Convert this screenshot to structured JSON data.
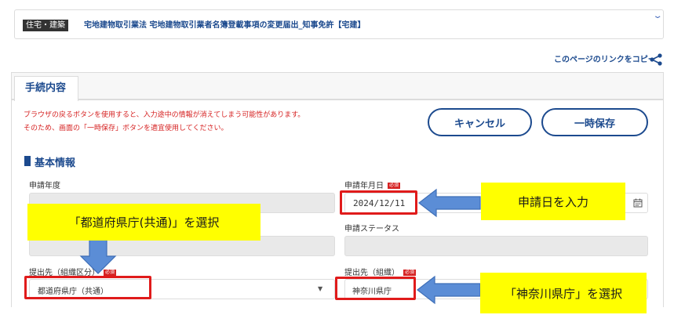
{
  "header": {
    "category_badge": "住宅・建築",
    "procedure_title": "宅地建物取引業法 宅地建物取引業者名簿登載事項の変更届出_知事免許【宅建】",
    "copy_link_label": "このページのリンクをコピー"
  },
  "tabs": [
    {
      "label": "手続内容",
      "active": true
    }
  ],
  "warnings": [
    "ブラウザの戻るボタンを使用すると、入力途中の情報が消えてしまう可能性があります。",
    "そのため、画面の「一時保存」ボタンを適宜使用してください。"
  ],
  "buttons": {
    "cancel": "キャンセル",
    "save_temp": "一時保存"
  },
  "section": {
    "title": "基本情報"
  },
  "required_badge": "必須",
  "fields": {
    "application_year": {
      "label": "申請年度",
      "value": ""
    },
    "application_date": {
      "label": "申請年月日",
      "value": "2024/12/11"
    },
    "application_status": {
      "label": "申請ステータス",
      "value": ""
    },
    "destination_type": {
      "label": "提出先（組織区分）",
      "value": "都道府県庁（共通）"
    },
    "destination_org": {
      "label": "提出先（組織）",
      "value": "神奈川県庁"
    }
  },
  "annotations": {
    "date_callout": "申請日を入力",
    "prefecture_callout": "「都道府県庁(共通)」を選択",
    "kanagawa_callout": "「神奈川県庁」を選択"
  },
  "colors": {
    "brand_blue": "#1c4a8e",
    "warning_red": "#d62222",
    "highlight_red": "#e01b1b",
    "callout_yellow": "#ffff00",
    "arrow_blue": "#5b8dd6"
  },
  "icons": [
    "chevron-down-icon",
    "share-icon",
    "calendar-icon",
    "dropdown-caret-icon",
    "arrow-left-icon",
    "arrow-down-icon"
  ]
}
